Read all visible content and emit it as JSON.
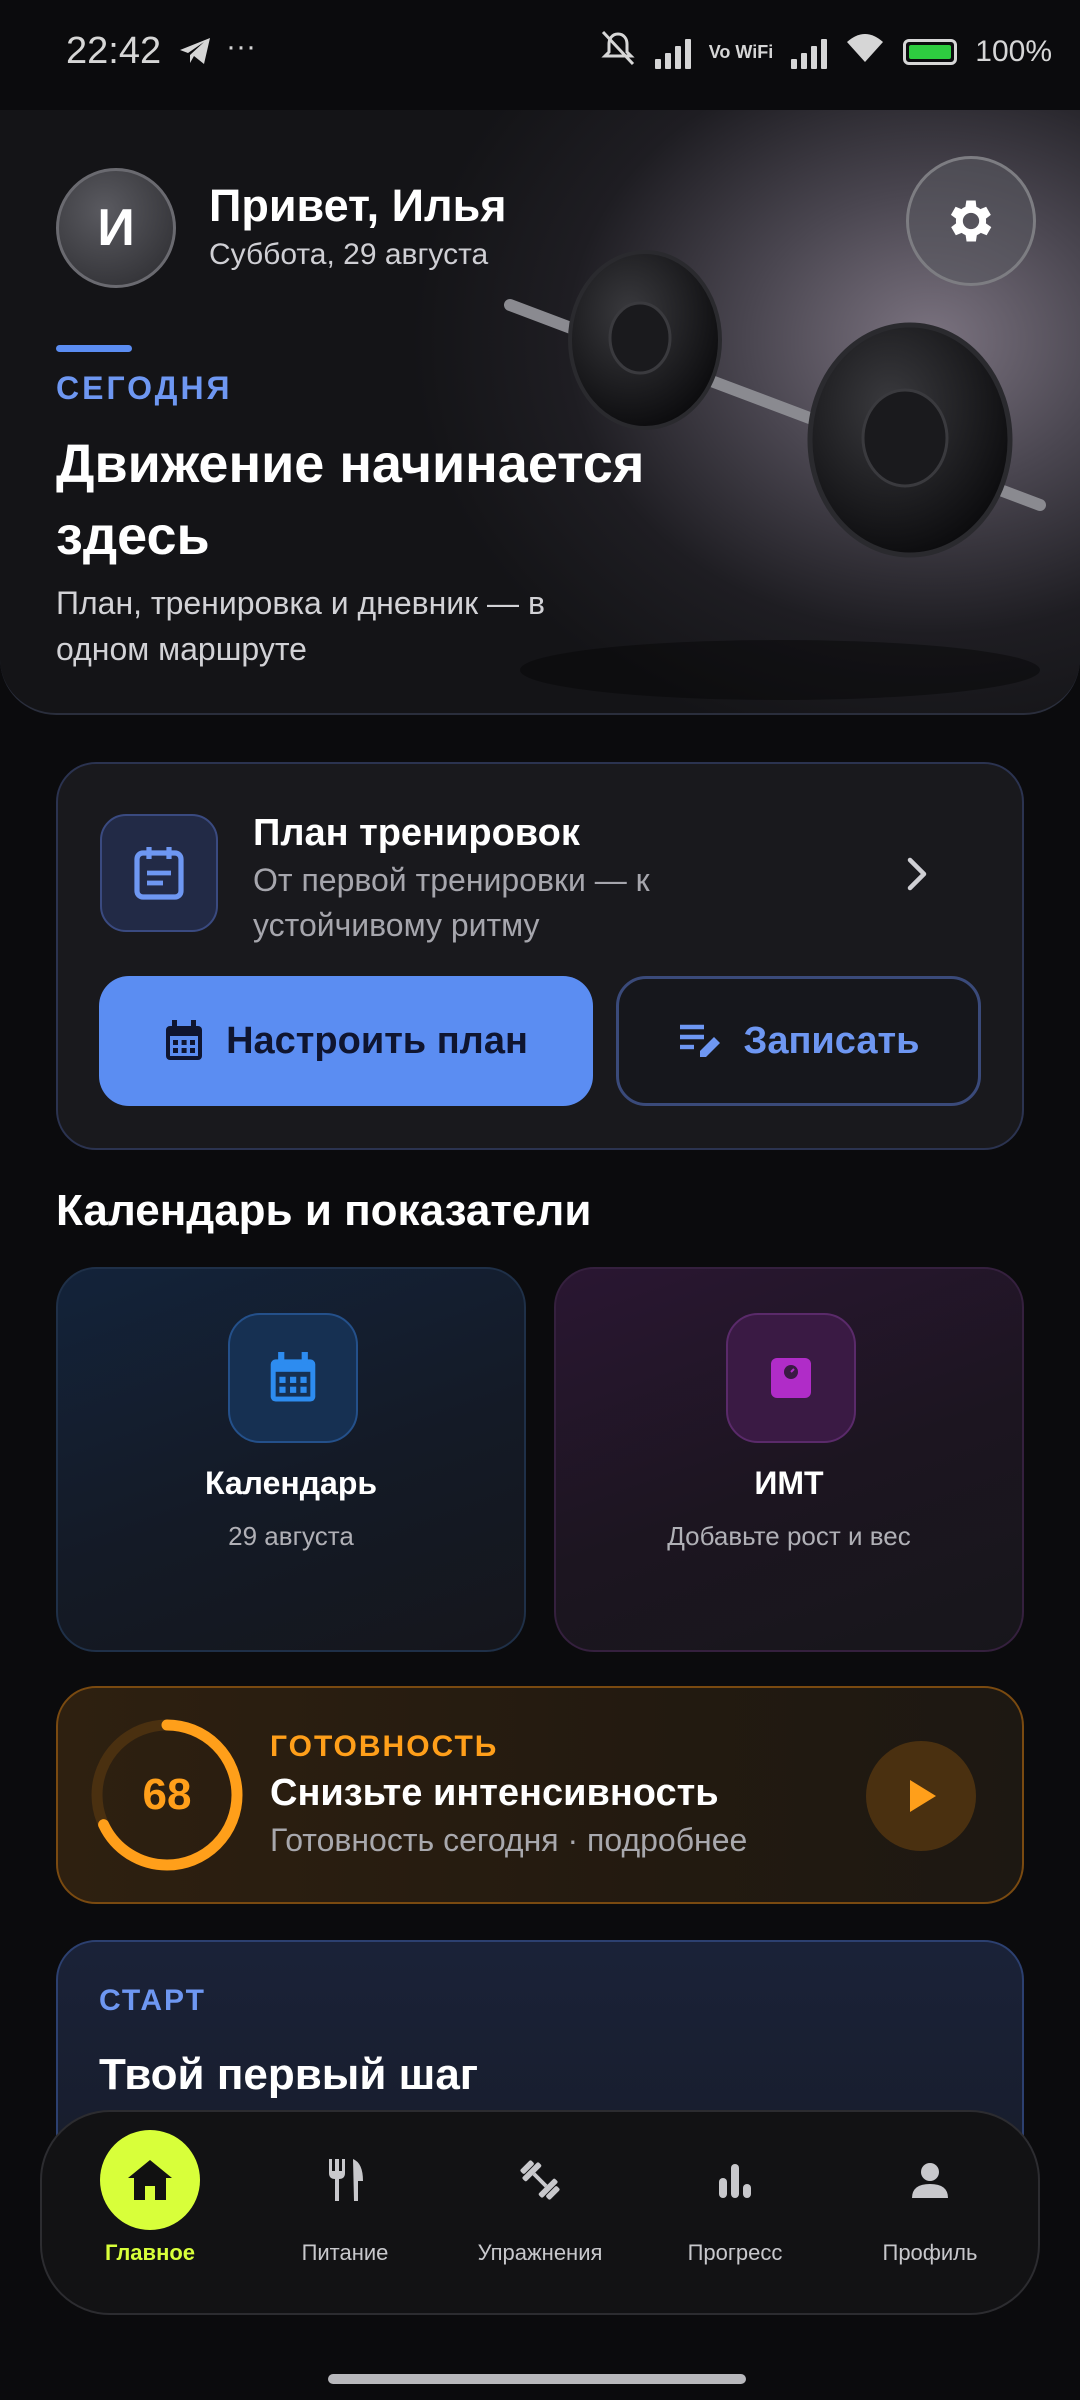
{
  "status_bar": {
    "time": "22:42",
    "battery": "100%",
    "wifi_label": "Vo WiFi"
  },
  "header": {
    "avatar_letter": "И",
    "greeting": "Привет, Илья",
    "date": "Суббота, 29 августа"
  },
  "hero": {
    "tag": "СЕГОДНЯ",
    "title": "Движение начинается здесь",
    "subtitle": "План, тренировка и дневник — в одном маршруте"
  },
  "plan": {
    "title": "План тренировок",
    "subtitle": "От первой тренировки — к устойчивому ритму",
    "setup_label": "Настроить план",
    "write_label": "Записать"
  },
  "section": {
    "title": "Календарь и показатели"
  },
  "tiles": {
    "calendar": {
      "title": "Календарь",
      "subtitle": "29 августа"
    },
    "bmi": {
      "title": "ИМТ",
      "subtitle": "Добавьте рост и вес"
    }
  },
  "readiness": {
    "value": "68",
    "progress": 0.68,
    "label": "ГОТОВНОСТЬ",
    "title": "Снизьте интенсивность",
    "subtitle": "Готовность сегодня · подробнее"
  },
  "start": {
    "label": "СТАРТ",
    "title": "Твой первый шаг"
  },
  "nav": {
    "items": [
      {
        "label": "Главное",
        "icon": "home-icon",
        "active": true
      },
      {
        "label": "Питание",
        "icon": "fork-knife-icon"
      },
      {
        "label": "Упражнения",
        "icon": "dumbbell-icon"
      },
      {
        "label": "Прогресс",
        "icon": "bar-chart-icon"
      },
      {
        "label": "Профиль",
        "icon": "person-icon"
      }
    ]
  },
  "colors": {
    "accent_blue": "#5b8df2",
    "accent_orange": "#ff9f1a",
    "accent_lime": "#d8ff3a",
    "background": "#0b0b0d"
  }
}
